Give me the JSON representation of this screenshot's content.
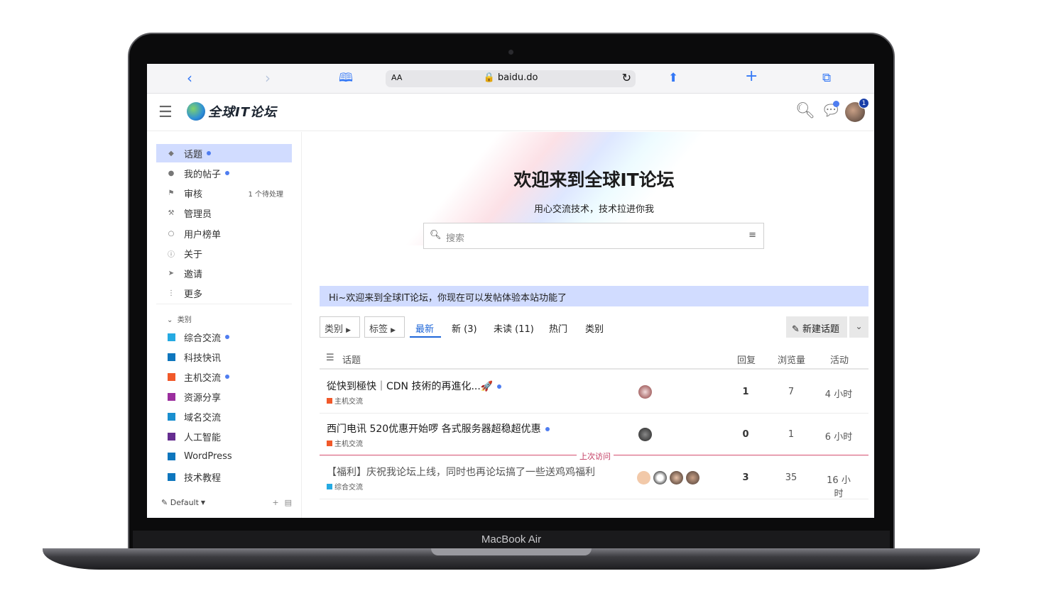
{
  "device": {
    "label": "MacBook Air"
  },
  "browser": {
    "text_size_label": "AA",
    "url": "baidu.do",
    "back_icon": "chevron-left-icon",
    "forward_icon": "chevron-right-icon",
    "bookmarks_icon": "book-icon",
    "share_icon": "share-icon",
    "newtab_icon": "plus-icon",
    "tabs_icon": "tabs-icon",
    "reload_icon": "reload-icon",
    "lock_icon": "lock-icon"
  },
  "header": {
    "logo_text": "全球IT论坛",
    "notification_count": "1"
  },
  "sidebar": {
    "items": [
      {
        "label": "话题",
        "icon": "layers-icon",
        "dot": true
      },
      {
        "label": "我的帖子",
        "icon": "user-icon",
        "dot": true
      },
      {
        "label": "审核",
        "icon": "flag-icon",
        "count": "1 个待处理"
      },
      {
        "label": "管理员",
        "icon": "wrench-icon"
      },
      {
        "label": "用户榜单",
        "icon": "users-icon"
      },
      {
        "label": "关于",
        "icon": "info-icon"
      },
      {
        "label": "邀请",
        "icon": "send-icon"
      },
      {
        "label": "更多",
        "icon": "more-icon"
      }
    ],
    "categories_header": "类别",
    "categories": [
      {
        "label": "综合交流",
        "color": "#25AAE2",
        "dot": true
      },
      {
        "label": "科技快讯",
        "color": "#0E76BD",
        "dot": false
      },
      {
        "label": "主机交流",
        "color": "#F1592A",
        "dot": true
      },
      {
        "label": "资源分享",
        "color": "#9B2E9E",
        "dot": false
      },
      {
        "label": "域名交流",
        "color": "#1A8FCF",
        "dot": false
      },
      {
        "label": "人工智能",
        "color": "#652D90",
        "dot": false
      },
      {
        "label": "WordPress",
        "color": "#0E76BD",
        "dot": false
      },
      {
        "label": "技术教程",
        "color": "#0E76BD",
        "dot": false
      }
    ],
    "theme_label": "Default"
  },
  "banner": {
    "title": "欢迎来到全球IT论坛",
    "subtitle": "用心交流技术，技术拉进你我",
    "search_placeholder": "搜索"
  },
  "notice": "Hi~欢迎来到全球IT论坛，你现在可以发帖体验本站功能了",
  "nav": {
    "category_dropdown": "类别",
    "tag_dropdown": "标签",
    "tabs": [
      "最新",
      "新 (3)",
      "未读 (11)",
      "热门",
      "类别"
    ],
    "active_tab": 0,
    "new_topic": "新建话题"
  },
  "table": {
    "headers": {
      "topic": "话题",
      "replies": "回复",
      "views": "浏览量",
      "activity": "活动"
    },
    "rows": [
      {
        "title": "從快到極快｜CDN 技術的再進化...🚀",
        "category": "主机交流",
        "category_color": "#F1592A",
        "replies": "1",
        "views": "7",
        "activity": "4 小时",
        "dot": true,
        "visited": false
      },
      {
        "title": "西门电讯 520优惠开始啰 各式服务器超稳超优惠",
        "category": "主机交流",
        "category_color": "#F1592A",
        "replies": "0",
        "views": "1",
        "activity": "6 小时",
        "dot": true,
        "visited": false
      },
      {
        "title": "【福利】庆祝我论坛上线，同时也再论坛搞了一些送鸡鸡福利",
        "category": "综合交流",
        "category_color": "#25AAE2",
        "replies": "3",
        "views": "35",
        "activity": "16 小时",
        "dot": false,
        "visited": true
      }
    ],
    "last_visit_label": "上次访问"
  }
}
